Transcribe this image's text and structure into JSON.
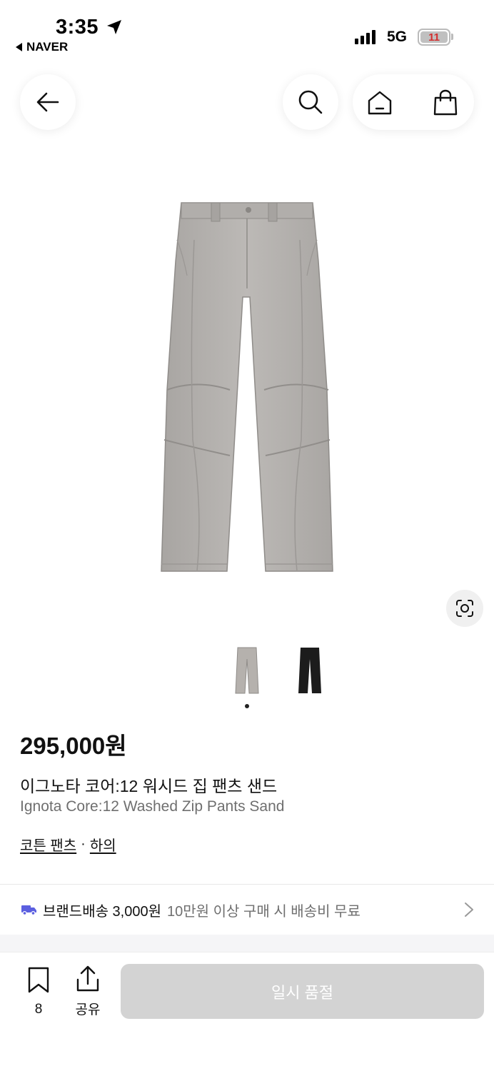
{
  "status_bar": {
    "time": "3:35",
    "back_app": "NAVER",
    "network": "5G",
    "battery": "11"
  },
  "product": {
    "price": "295,000원",
    "title_ko": "이그노타 코어:12 워시드 집 팬츠 샌드",
    "title_en": "Ignota Core:12 Washed Zip Pants Sand",
    "categories": [
      "코튼 팬츠",
      "하의"
    ],
    "category_separator": "·",
    "thumbnails": [
      {
        "color_name": "sand",
        "color": "#b5b1ad"
      },
      {
        "color_name": "black",
        "color": "#1c1c1c"
      }
    ],
    "image_color": "#b3b0ad"
  },
  "shipping": {
    "label": "브랜드배송 3,000원",
    "sub": "10만원 이상 구매 시 배송비 무료",
    "accent": "#5b5fe0"
  },
  "bottom_bar": {
    "bookmark_count": "8",
    "share_label": "공유",
    "soldout_label": "일시 품절",
    "soldout_bg": "#d3d3d3"
  }
}
